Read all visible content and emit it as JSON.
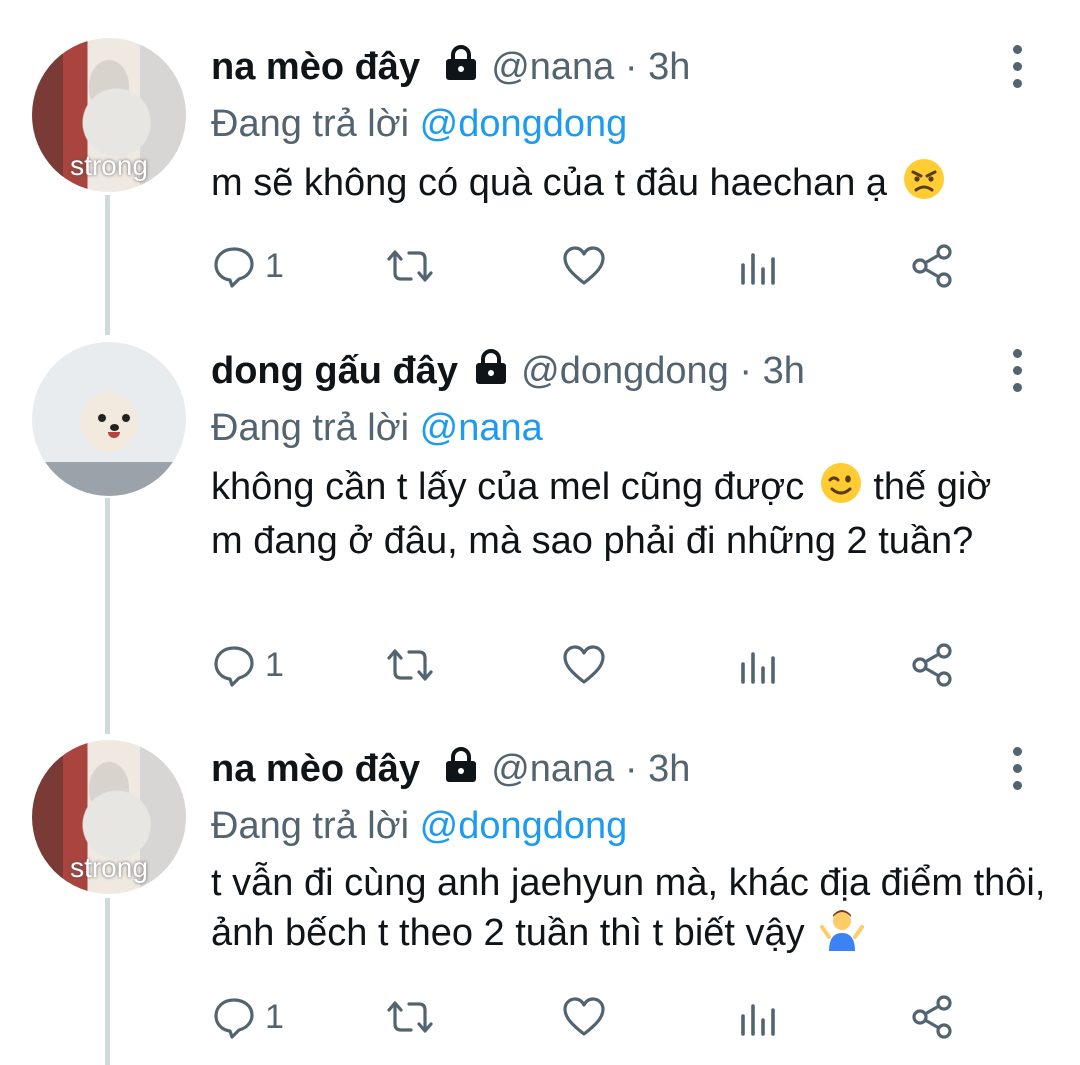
{
  "tweets": [
    {
      "name": "na mèo đây",
      "handle": "@nana",
      "dot": "·",
      "time": "3h",
      "replying_prefix": "Đang trả lời",
      "replying_to": "@dongdong",
      "text": "m sẽ không có quà của t đâu haechan ạ",
      "emoji": "angry-face-icon",
      "reply_count": "1",
      "avatar_label": "strong"
    },
    {
      "name": "dong gấu đây",
      "handle": "@dongdong",
      "dot": "·",
      "time": "3h",
      "replying_prefix": "Đang trả lời",
      "replying_to": "@nana",
      "text_a": "không cần t lấy của mel cũng được",
      "text_b": "thế giờ m đang ở đâu, mà sao phải đi những 2 tuần?",
      "emoji": "winking-face-icon",
      "reply_count": "1"
    },
    {
      "name": "na mèo đây",
      "handle": "@nana",
      "dot": "·",
      "time": "3h",
      "replying_prefix": "Đang trả lời",
      "replying_to": "@dongdong",
      "text": "t vẫn đi cùng anh jaehyun mà, khác địa điểm thôi, ảnh bếch t theo 2 tuần thì t biết vậy",
      "emoji": "person-shrugging-icon",
      "reply_count": "1",
      "avatar_label": "strong"
    }
  ],
  "colors": {
    "text": "#0f1419",
    "secondary": "#536471",
    "link": "#1d9bf0",
    "thread_line": "#cfd9de"
  }
}
